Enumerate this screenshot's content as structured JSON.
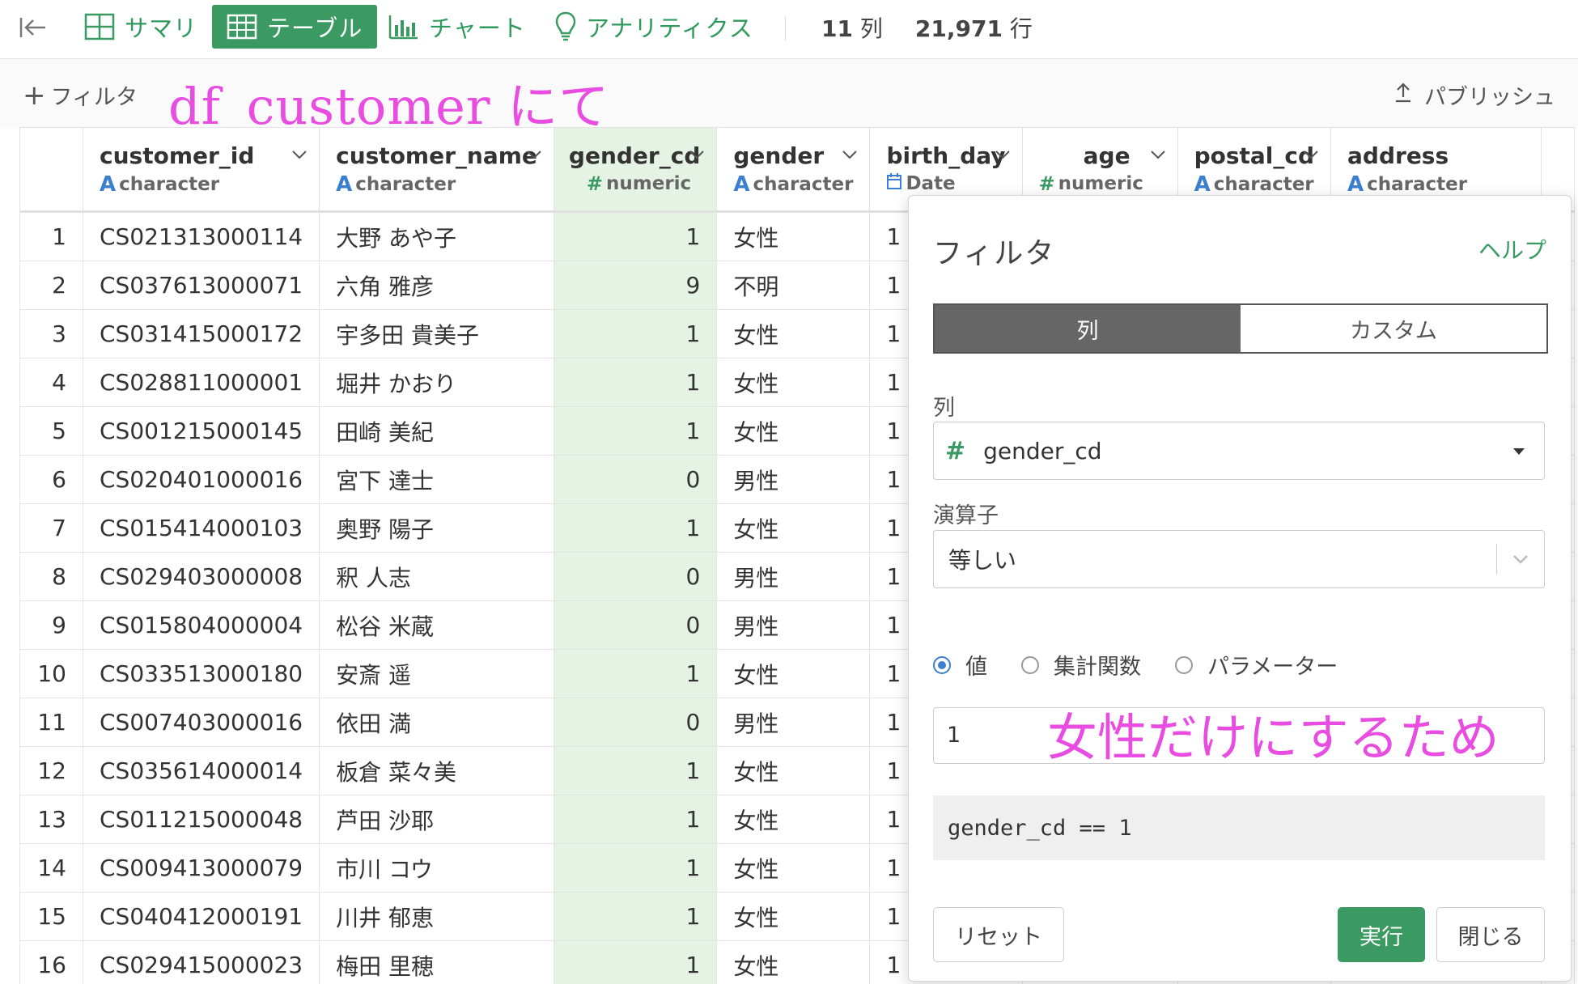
{
  "nav": {
    "items": [
      {
        "label": "サマリ",
        "icon": "summary-grid-icon"
      },
      {
        "label": "テーブル",
        "icon": "table-icon"
      },
      {
        "label": "チャート",
        "icon": "bar-chart-icon"
      },
      {
        "label": "アナリティクス",
        "icon": "lightbulb-icon"
      }
    ],
    "active": "テーブル",
    "cols_count": "11",
    "cols_unit": "列",
    "rows_count": "21,971",
    "rows_unit": "行"
  },
  "toolbar": {
    "add_filter": "フィルタ",
    "publish": "パブリッシュ",
    "annotation": "df_customer にて"
  },
  "columns": [
    {
      "name": "customer_id",
      "type": "character",
      "type_icon": "A"
    },
    {
      "name": "customer_name",
      "type": "character",
      "type_icon": "A"
    },
    {
      "name": "gender_cd",
      "type": "numeric",
      "type_icon": "#"
    },
    {
      "name": "gender",
      "type": "character",
      "type_icon": "A"
    },
    {
      "name": "birth_day",
      "type": "Date",
      "type_icon": "calendar"
    },
    {
      "name": "age",
      "type": "numeric",
      "type_icon": "#"
    },
    {
      "name": "postal_cd",
      "type": "character",
      "type_icon": "A"
    },
    {
      "name": "address",
      "type": "character",
      "type_icon": "A"
    }
  ],
  "rows": [
    {
      "n": "1",
      "id": "CS021313000114",
      "name": "大野 あや子",
      "gcd": "1",
      "gender": "女性",
      "bd": "1"
    },
    {
      "n": "2",
      "id": "CS037613000071",
      "name": "六角 雅彦",
      "gcd": "9",
      "gender": "不明",
      "bd": "1"
    },
    {
      "n": "3",
      "id": "CS031415000172",
      "name": "宇多田 貴美子",
      "gcd": "1",
      "gender": "女性",
      "bd": "1"
    },
    {
      "n": "4",
      "id": "CS028811000001",
      "name": "堀井 かおり",
      "gcd": "1",
      "gender": "女性",
      "bd": "1"
    },
    {
      "n": "5",
      "id": "CS001215000145",
      "name": "田崎 美紀",
      "gcd": "1",
      "gender": "女性",
      "bd": "1"
    },
    {
      "n": "6",
      "id": "CS020401000016",
      "name": "宮下 達士",
      "gcd": "0",
      "gender": "男性",
      "bd": "1"
    },
    {
      "n": "7",
      "id": "CS015414000103",
      "name": "奥野 陽子",
      "gcd": "1",
      "gender": "女性",
      "bd": "1"
    },
    {
      "n": "8",
      "id": "CS029403000008",
      "name": "釈 人志",
      "gcd": "0",
      "gender": "男性",
      "bd": "1"
    },
    {
      "n": "9",
      "id": "CS015804000004",
      "name": "松谷 米蔵",
      "gcd": "0",
      "gender": "男性",
      "bd": "1"
    },
    {
      "n": "10",
      "id": "CS033513000180",
      "name": "安斎 遥",
      "gcd": "1",
      "gender": "女性",
      "bd": "1"
    },
    {
      "n": "11",
      "id": "CS007403000016",
      "name": "依田 満",
      "gcd": "0",
      "gender": "男性",
      "bd": "1"
    },
    {
      "n": "12",
      "id": "CS035614000014",
      "name": "板倉 菜々美",
      "gcd": "1",
      "gender": "女性",
      "bd": "1"
    },
    {
      "n": "13",
      "id": "CS011215000048",
      "name": "芦田 沙耶",
      "gcd": "1",
      "gender": "女性",
      "bd": "1"
    },
    {
      "n": "14",
      "id": "CS009413000079",
      "name": "市川 コウ",
      "gcd": "1",
      "gender": "女性",
      "bd": "1"
    },
    {
      "n": "15",
      "id": "CS040412000191",
      "name": "川井 郁恵",
      "gcd": "1",
      "gender": "女性",
      "bd": "1"
    },
    {
      "n": "16",
      "id": "CS029415000023",
      "name": "梅田 里穂",
      "gcd": "1",
      "gender": "女性",
      "bd": "1"
    }
  ],
  "filter_panel": {
    "title": "フィルタ",
    "help": "ヘルプ",
    "tabs": [
      "列",
      "カスタム"
    ],
    "active_tab": "列",
    "column_label": "列",
    "column_value": "gender_cd",
    "operator_label": "演算子",
    "operator_value": "等しい",
    "radio_options": [
      "値",
      "集計関数",
      "パラメーター"
    ],
    "radio_selected": "値",
    "value": "1",
    "value_annotation": "女性だけにするため",
    "expression": "gender_cd == 1",
    "reset": "リセット",
    "run": "実行",
    "close": "閉じる"
  },
  "colors": {
    "accent_green": "#3a9a62",
    "highlight_col": "#e4f3e4",
    "annotation_pink": "#e84ce0",
    "type_blue": "#3b7fd0"
  }
}
